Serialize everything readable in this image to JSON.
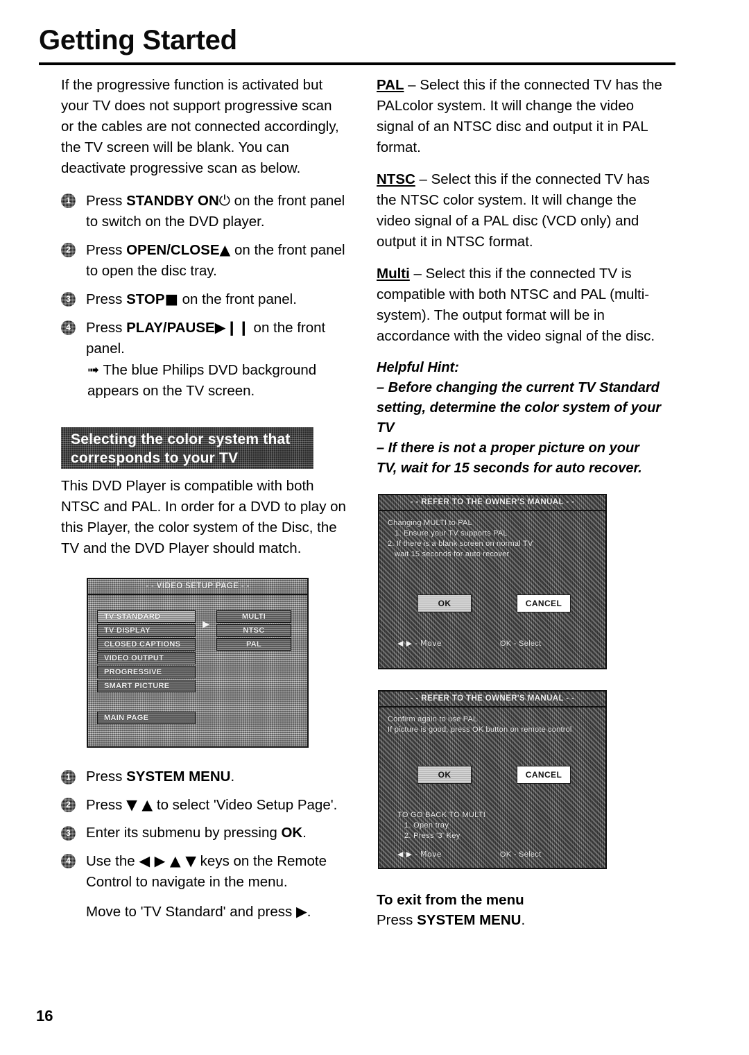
{
  "page": {
    "title": "Getting Started",
    "number": "16"
  },
  "left": {
    "intro": "If the progressive function is activated but your TV does not support progressive scan or the cables are not connected accordingly, the TV screen will be blank. You can deactivate progressive scan as below.",
    "steps": [
      {
        "num": "1",
        "pre": "Press ",
        "bold": "STANDBY ON",
        "icon": "⏻",
        "post": " on the front panel to switch on the DVD player."
      },
      {
        "num": "2",
        "pre": "Press ",
        "bold": "OPEN/CLOSE",
        "icon": "▲",
        "post": " on the front panel to open the disc tray."
      },
      {
        "num": "3",
        "pre": "Press ",
        "bold": "STOP",
        "icon": "■",
        "post": " on the front panel."
      },
      {
        "num": "4",
        "pre": "Press ",
        "bold": "PLAY/PAUSE",
        "icon": "▶❙❙",
        "post": " on the front panel.",
        "note": "The blue Philips DVD background appears on the TV screen.",
        "note_arrow": "➟"
      }
    ],
    "banner": {
      "line1": "Selecting the color system that",
      "line2": "corresponds to your TV"
    },
    "compat_text": "This DVD Player is compatible with both NTSC and PAL. In order for a DVD to play on this Player, the color system of the Disc, the TV and the DVD Player should match.",
    "steps2": [
      {
        "num": "1",
        "pre": "Press ",
        "bold": "SYSTEM MENU",
        "post": "."
      },
      {
        "num": "2",
        "pre": "Press ",
        "icon": "▼ ▲",
        "post": " to select 'Video Setup Page'."
      },
      {
        "num": "3",
        "pre": "Enter its submenu by pressing ",
        "bold": "OK",
        "post": "."
      },
      {
        "num": "4",
        "pre": "Use the ",
        "icon": "◀ ▶ ▲ ▼",
        "post": " keys on the Remote Control to navigate in the menu."
      }
    ],
    "move_note_pre": "Move to 'TV Standard' and press ",
    "move_note_icon": "▶",
    "move_note_post": "."
  },
  "right": {
    "pal": {
      "term": "PAL",
      "text": " – Select this if the connected TV has the PALcolor system. It will change the video signal of an NTSC disc and output it in PAL format."
    },
    "ntsc": {
      "term": "NTSC",
      "text": " – Select this if the connected TV has the NTSC color system. It will change the video signal of a PAL disc (VCD only) and output it in NTSC format."
    },
    "multi": {
      "term": "Multi",
      "text": " – Select this if the connected TV is compatible with both NTSC and PAL (multi-system). The output format will be in accordance with the video signal of the disc."
    },
    "hint": {
      "heading": "Helpful Hint:",
      "items": [
        "–   Before changing the current TV Standard setting, determine the color system of your TV",
        "–   If there is not a proper picture on your TV, wait for 15 seconds for auto recover."
      ]
    },
    "exit": {
      "heading": "To exit from the menu",
      "pre": "Press ",
      "bold": "SYSTEM MENU",
      "post": "."
    }
  },
  "screens": {
    "video_setup": {
      "title": "- - VIDEO SETUP PAGE - -",
      "left_items": [
        "TV STANDARD",
        "TV DISPLAY",
        "CLOSED CAPTIONS",
        "VIDEO OUTPUT",
        "PROGRESSIVE",
        "SMART PICTURE"
      ],
      "right_items": [
        "MULTI",
        "NTSC",
        "PAL"
      ],
      "main_page": "MAIN PAGE",
      "arrow": "▶"
    },
    "dialog1": {
      "title": "- - REFER TO THE OWNER'S MANUAL - -",
      "lines": [
        "Changing MULTI to PAL",
        "1. Ensure your TV supports PAL",
        "2. If there is a blank screen on normal TV",
        "wait 15 seconds for auto recover"
      ],
      "ok": "OK",
      "cancel": "CANCEL",
      "hint_move": "◀ ▶  - Move",
      "hint_select": "OK - Select"
    },
    "dialog2": {
      "title": "- - REFER TO THE OWNER'S MANUAL - -",
      "lines": [
        "Confirm again to use PAL",
        "If picture is good, press OK button on remote control"
      ],
      "ok": "OK",
      "cancel": "CANCEL",
      "back_lines": [
        "TO GO BACK TO MULTI",
        "1. Open tray",
        "2. Press '3' Key"
      ],
      "hint_move": "◀ ▶  - Move",
      "hint_select": "OK - Select"
    }
  }
}
